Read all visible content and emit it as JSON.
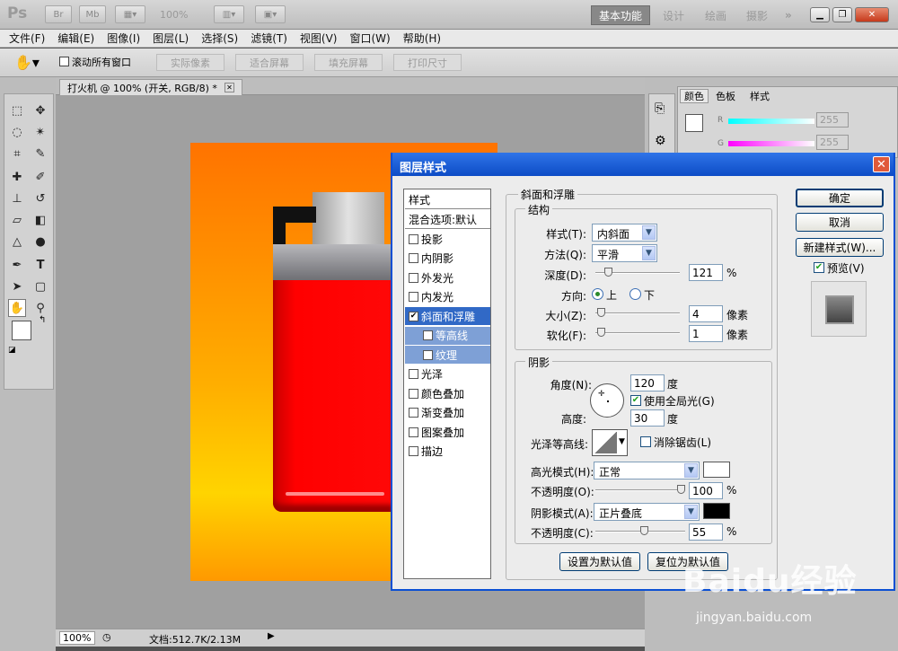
{
  "app": {
    "logo": "Ps",
    "zoom": "100%",
    "workspaces": [
      "基本功能",
      "设计",
      "绘画",
      "摄影"
    ],
    "more": "»",
    "extras": [
      "Br",
      "Mb"
    ]
  },
  "menu": [
    "文件(F)",
    "编辑(E)",
    "图像(I)",
    "图层(L)",
    "选择(S)",
    "滤镜(T)",
    "视图(V)",
    "窗口(W)",
    "帮助(H)"
  ],
  "options": {
    "scroll_all": "滚动所有窗口",
    "buttons": [
      "实际像素",
      "适合屏幕",
      "填充屏幕",
      "打印尺寸"
    ]
  },
  "document": {
    "tab": "打火机 @ 100% (开关, RGB/8) *",
    "zoom": "100%",
    "status": "文档:512.7K/2.13M"
  },
  "panels": {
    "tabs": [
      "颜色",
      "色板",
      "样式"
    ],
    "r_label": "R",
    "r_value": "255",
    "g_label": "G",
    "g_value": "255"
  },
  "dialog": {
    "title": "图层样式",
    "style_list": [
      {
        "label": "样式",
        "checkbox": false,
        "selected": false,
        "indent": false,
        "header": true
      },
      {
        "label": "混合选项:默认",
        "checkbox": false,
        "selected": false,
        "indent": false,
        "header": true
      },
      {
        "label": "投影",
        "checkbox": true,
        "checked": false
      },
      {
        "label": "内阴影",
        "checkbox": true,
        "checked": false
      },
      {
        "label": "外发光",
        "checkbox": true,
        "checked": false
      },
      {
        "label": "内发光",
        "checkbox": true,
        "checked": false
      },
      {
        "label": "斜面和浮雕",
        "checkbox": true,
        "checked": true,
        "selected": true
      },
      {
        "label": "等高线",
        "checkbox": true,
        "checked": false,
        "indent": true,
        "sub": true
      },
      {
        "label": "纹理",
        "checkbox": true,
        "checked": false,
        "indent": true,
        "sub": true
      },
      {
        "label": "光泽",
        "checkbox": true,
        "checked": false
      },
      {
        "label": "颜色叠加",
        "checkbox": true,
        "checked": false
      },
      {
        "label": "渐变叠加",
        "checkbox": true,
        "checked": false
      },
      {
        "label": "图案叠加",
        "checkbox": true,
        "checked": false
      },
      {
        "label": "描边",
        "checkbox": true,
        "checked": false
      }
    ],
    "section_title": "斜面和浮雕",
    "structure": {
      "title": "结构",
      "style_label": "样式(T):",
      "style_value": "内斜面",
      "technique_label": "方法(Q):",
      "technique_value": "平滑",
      "depth_label": "深度(D):",
      "depth_value": "121",
      "depth_unit": "%",
      "depth_pct": 0.12,
      "direction_label": "方向:",
      "dir_up": "上",
      "dir_down": "下",
      "size_label": "大小(Z):",
      "size_value": "4",
      "size_unit": "像素",
      "size_pct": 0.02,
      "soften_label": "软化(F):",
      "soften_value": "1",
      "soften_unit": "像素",
      "soften_pct": 0.02
    },
    "shading": {
      "title": "阴影",
      "angle_label": "角度(N):",
      "angle_value": "120",
      "angle_unit": "度",
      "global_light": "使用全局光(G)",
      "altitude_label": "高度:",
      "altitude_value": "30",
      "altitude_unit": "度",
      "gloss_label": "光泽等高线:",
      "anti_alias": "消除锯齿(L)",
      "highlight_label": "高光模式(H):",
      "highlight_value": "正常",
      "highlight_color": "#ffffff",
      "h_opacity_label": "不透明度(O):",
      "h_opacity_value": "100",
      "h_opacity_pct": 1.0,
      "shadow_label": "阴影模式(A):",
      "shadow_value": "正片叠底",
      "shadow_color": "#000000",
      "s_opacity_label": "不透明度(C):",
      "s_opacity_value": "55",
      "s_opacity_pct": 0.55,
      "pct": "%"
    },
    "make_default": "设置为默认值",
    "reset_default": "复位为默认值",
    "ok": "确定",
    "cancel": "取消",
    "new_style": "新建样式(W)...",
    "preview": "预览(V)"
  },
  "watermark": {
    "main": "Baidu经验",
    "sub": "jingyan.baidu.com"
  },
  "colors": {
    "accent": "#0a4fd3",
    "orange": "#ff7a00",
    "red": "#ff0000",
    "selected": "#3169c6"
  }
}
